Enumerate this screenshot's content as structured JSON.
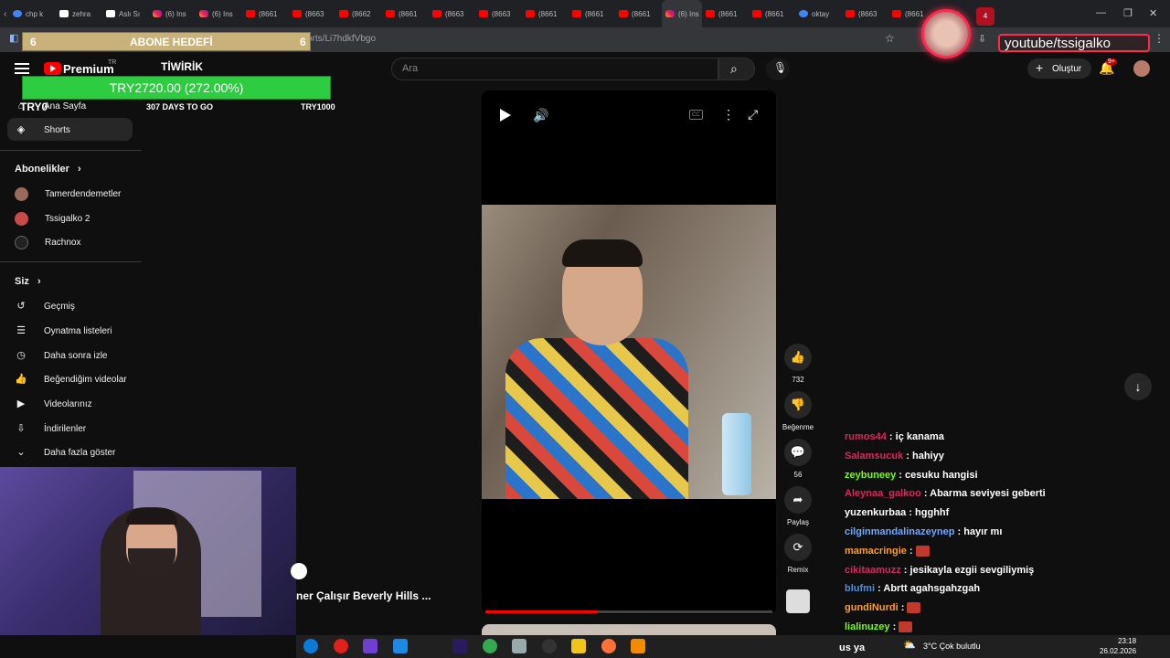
{
  "browser": {
    "tabs": [
      {
        "label": "chp k",
        "icon": "g"
      },
      {
        "label": "zehra",
        "icon": "t"
      },
      {
        "label": "Aslı Sı",
        "icon": "t"
      },
      {
        "label": "(6) Ins",
        "icon": "ig"
      },
      {
        "label": "(6) Ins",
        "icon": "ig"
      },
      {
        "label": "(8661",
        "icon": "yt"
      },
      {
        "label": "(8663",
        "icon": "yt"
      },
      {
        "label": "(8662",
        "icon": "yt"
      },
      {
        "label": "(8661",
        "icon": "yt"
      },
      {
        "label": "(8663",
        "icon": "yt"
      },
      {
        "label": "(8663",
        "icon": "yt"
      },
      {
        "label": "(8661",
        "icon": "yt"
      },
      {
        "label": "(8661",
        "icon": "yt"
      },
      {
        "label": "(8661",
        "icon": "yt"
      },
      {
        "label": "(6) Ins",
        "icon": "ig"
      },
      {
        "label": "(8661",
        "icon": "yt"
      },
      {
        "label": "(8661",
        "icon": "yt"
      },
      {
        "label": "oktay",
        "icon": "g"
      },
      {
        "label": "(8663",
        "icon": "yt"
      },
      {
        "label": "(8661",
        "icon": "yt"
      }
    ],
    "active_tab_close": "×",
    "url_fragment": "orts/Li7hdkfVbgo"
  },
  "overlay": {
    "goal_title": "ABONE HEDEFİ",
    "goal_left": "6",
    "goal_right": "6",
    "tiwirik": "TİWİRİK",
    "progress_text": "TRY2720.00 (272.00%)",
    "days": "307 DAYS TO GO",
    "try_left": "TRY0",
    "try_right": "TRY1000"
  },
  "youtube": {
    "logo_text": "Premium",
    "logo_region": "TR",
    "search_placeholder": "Ara",
    "create_label": "Oluştur",
    "notif_badge": "9+"
  },
  "sidebar": {
    "home": "Ana Sayfa",
    "shorts": "Shorts",
    "subs_header": "Abonelikler",
    "subs": [
      "Tamerdendemetler",
      "Tssigalko 2",
      "Rachnox"
    ],
    "you_header": "Siz",
    "you_items": [
      "Geçmiş",
      "Oynatma listeleri",
      "Daha sonra izle",
      "Beğendiğim videolar",
      "Videolarınız",
      "İndirilenler",
      "Daha fazla göster"
    ]
  },
  "player": {
    "like_count": "732",
    "dislike_label": "Beğenme",
    "comment_count": "56",
    "share_label": "Paylaş",
    "remix_label": "Remix",
    "progress": 0.39,
    "next_title": "ner Çalışır Beverly Hills ..."
  },
  "chat": [
    {
      "user": "rumos44",
      "color": "#e0245e",
      "msg": "iç kanama"
    },
    {
      "user": "Salamsucuk",
      "color": "#e0245e",
      "msg": "hahiyy"
    },
    {
      "user": "zeybuneey",
      "color": "#7cfc00",
      "msg": "cesuku hangisi"
    },
    {
      "user": "Aleynaa_galkoo",
      "color": "#e0245e",
      "msg": "Abarma seviyesi geberti"
    },
    {
      "user": "yuzenkurbaa",
      "color": "#ffffff",
      "msg": "hgghhf"
    },
    {
      "user": "cilginmandalinazeynep",
      "color": "#6fa8ff",
      "msg": "hayır mı"
    },
    {
      "user": "mamacringie",
      "color": "#ff9f1a",
      "msg": ""
    },
    {
      "user": "cikitaamuzz",
      "color": "#e0245e",
      "msg": "jesikayla ezgii sevgiliymiş"
    },
    {
      "user": "blufmi",
      "color": "#4a90e2",
      "msg": "Abrtt agahsgahzgah"
    },
    {
      "user": "gundiNurdi",
      "color": "#ff9f1a",
      "msg": ""
    },
    {
      "user": "lialinuzey",
      "color": "#7cfc00",
      "msg": ""
    }
  ],
  "streamer": {
    "handle": "youtube/tssigalko",
    "shield": "4"
  },
  "taskbar": {
    "lang": "us ya",
    "weather": "3°C  Çok bulutlu",
    "time": "23:18",
    "date": "26.02.2026"
  }
}
